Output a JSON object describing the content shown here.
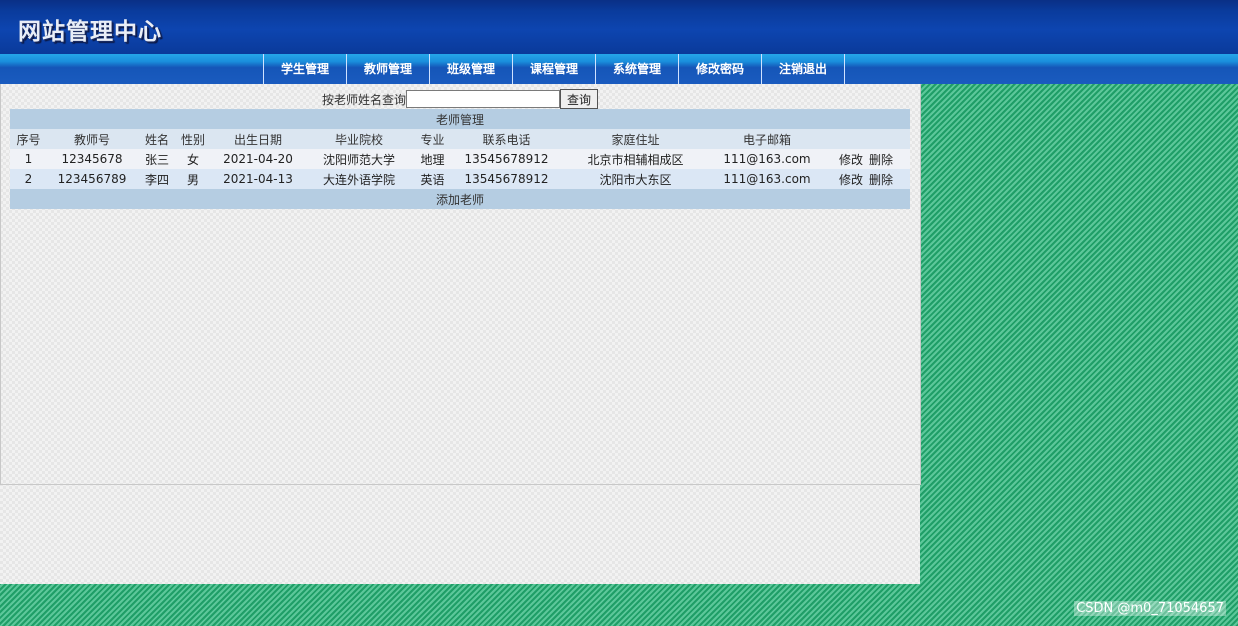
{
  "header": {
    "logo": "网站管理中心"
  },
  "nav": {
    "items": [
      "学生管理",
      "教师管理",
      "班级管理",
      "课程管理",
      "系统管理",
      "修改密码",
      "注销退出"
    ]
  },
  "search": {
    "label": "按老师姓名查询",
    "value": "",
    "button": "查询"
  },
  "table": {
    "title": "老师管理",
    "columns": [
      "序号",
      "教师号",
      "姓名",
      "性别",
      "出生日期",
      "毕业院校",
      "专业",
      "联系电话",
      "家庭住址",
      "电子邮箱",
      ""
    ],
    "rows": [
      [
        "1",
        "12345678",
        "张三",
        "女",
        "2021-04-20",
        "沈阳师范大学",
        "地理",
        "13545678912",
        "北京市相辅相成区",
        "111@163.com"
      ],
      [
        "2",
        "123456789",
        "李四",
        "男",
        "2021-04-13",
        "大连外语学院",
        "英语",
        "13545678912",
        "沈阳市大东区",
        "111@163.com"
      ]
    ],
    "edit_label": "修改",
    "delete_label": "删除",
    "add_label": "添加老师"
  },
  "watermark": "CSDN @m0_71054657",
  "colors": {
    "header": "#0a3b9c",
    "nav": "#1a5bbf",
    "table_title": "#b5cde2",
    "background": "#1fa36b"
  }
}
